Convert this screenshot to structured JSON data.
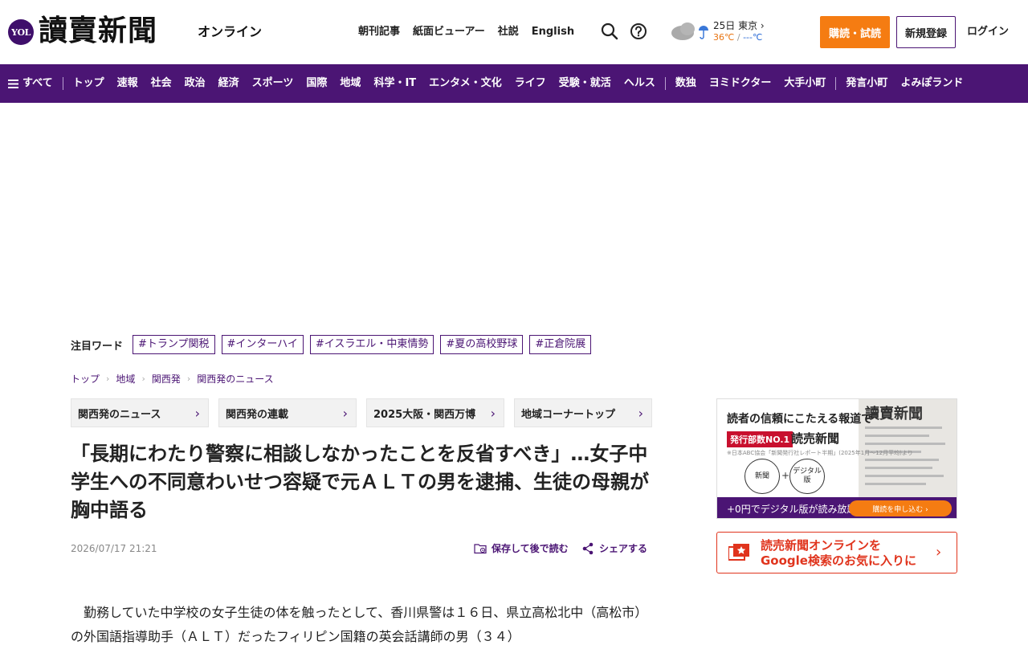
{
  "header": {
    "logo_badge": "YOL",
    "logo_text": "讀賣新聞",
    "logo_sub": "オンライン",
    "topnav": [
      "朝刊記事",
      "紙面ビューアー",
      "社説",
      "English"
    ],
    "weather": {
      "date_city": "25日 東京 ›",
      "high": "36℃",
      "sep": "/",
      "low": "---℃"
    },
    "subscribe_label": "購読・試読",
    "register_label": "新規登録",
    "login_label": "ログイン"
  },
  "catnav": {
    "all_label": "すべて",
    "items_a": [
      "トップ",
      "速報",
      "社会",
      "政治",
      "経済",
      "スポーツ",
      "国際",
      "地域",
      "科学・IT",
      "エンタメ・文化",
      "ライフ",
      "受験・就活",
      "ヘルス"
    ],
    "items_b": [
      "数独",
      "ヨミドクター",
      "大手小町"
    ],
    "items_c": [
      "発言小町",
      "よみぽランド"
    ]
  },
  "trending": {
    "label": "注目ワード",
    "tags": [
      "#トランプ関税",
      "#インターハイ",
      "#イスラエル・中東情勢",
      "#夏の高校野球",
      "#正倉院展"
    ]
  },
  "breadcrumb": [
    "トップ",
    "地域",
    "関西発",
    "関西発のニュース"
  ],
  "section_links": [
    "関西発のニュース",
    "関西発の連載",
    "2025大阪・関西万博",
    "地域コーナートップ"
  ],
  "article": {
    "title": "「長期にわたり警察に相談しなかったことを反省すべき」…女子中学生への不同意わいせつ容疑で元ＡＬＴの男を逮捕、生徒の母親が胸中語る",
    "date": "2026/07/17 21:21",
    "save_label": "保存して後で読む",
    "share_label": "シェアする",
    "body": "　勤務していた中学校の女子生徒の体を触ったとして、香川県警は１６日、県立高松北中（高松市）の外国語指導助手（ＡＬＴ）だったフィリピン国籍の英会話講師の男（３４）"
  },
  "sidebar": {
    "ad_headline": "読者の信頼にこたえる報道で",
    "ad_badge": "発行部数NO.1",
    "ad_brand": "読売新聞",
    "ad_note": "※日本ABC協会「新聞発行社レポート半期」(2025年1月〜12月平均)より",
    "ad_circle_1": "新聞",
    "ad_circle_2": "デジタル版",
    "ad_plus": "+",
    "ad_paper_title": "讀賣新聞",
    "ad_bottom_text": "+0円でデジタル版が読み放題!",
    "ad_cta": "購読を申し込む ›",
    "google_text_1": "読売新聞オンラインを",
    "google_text_2": "Google検索のお気に入りに"
  },
  "colors": {
    "brand_purple": "#4b1574",
    "accent_orange": "#f57c12",
    "google_red": "#e0341d"
  }
}
